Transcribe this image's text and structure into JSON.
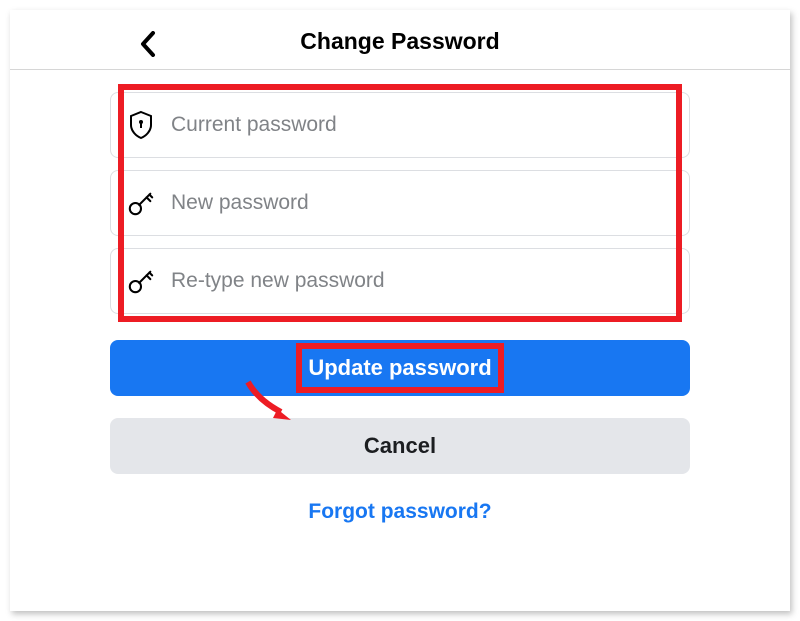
{
  "header": {
    "title": "Change Password"
  },
  "fields": {
    "current": {
      "placeholder": "Current password"
    },
    "new": {
      "placeholder": "New password"
    },
    "retype": {
      "placeholder": "Re-type new password"
    }
  },
  "buttons": {
    "update": "Update password",
    "cancel": "Cancel"
  },
  "link": {
    "forgot": "Forgot password?"
  },
  "annotations": {
    "highlight_color": "#ed1c24",
    "primary_color": "#1877f2"
  }
}
